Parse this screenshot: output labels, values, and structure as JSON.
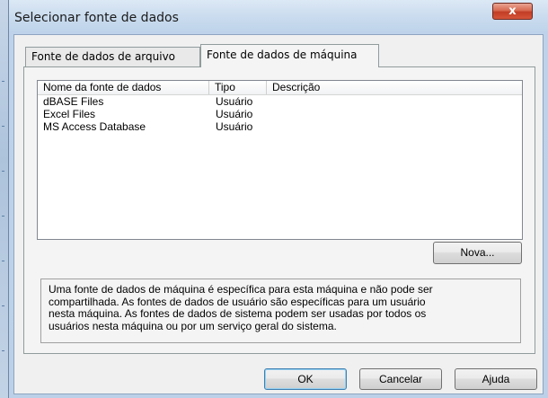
{
  "window": {
    "title": "Selecionar fonte de dados",
    "close_glyph": "x"
  },
  "tabs": [
    {
      "label": "Fonte de dados de arquivo",
      "active": false
    },
    {
      "label": "Fonte de dados de máquina",
      "active": true
    }
  ],
  "list": {
    "columns": [
      "Nome da fonte de dados",
      "Tipo",
      "Descrição"
    ],
    "rows": [
      {
        "name": "dBASE Files",
        "type": "Usuário",
        "description": ""
      },
      {
        "name": "Excel Files",
        "type": "Usuário",
        "description": ""
      },
      {
        "name": "MS Access Database",
        "type": "Usuário",
        "description": ""
      }
    ]
  },
  "buttons": {
    "new": "Nova...",
    "ok": "OK",
    "cancel": "Cancelar",
    "help": "Ajuda"
  },
  "info_text": "Uma fonte de dados de máquina é específica para esta máquina e não pode ser\ncompartilhada. As fontes de dados de usuário são específicas para um usuário\nnesta máquina. As fontes de dados de sistema podem ser usadas por todos os\nusuários nesta máquina ou por um serviço geral do sistema.",
  "colors": {
    "close_button": "#c7432b",
    "window_frame": "#bcd1e8",
    "dialog_face": "#f0f0f0",
    "default_button_border": "#3c7fb1"
  }
}
